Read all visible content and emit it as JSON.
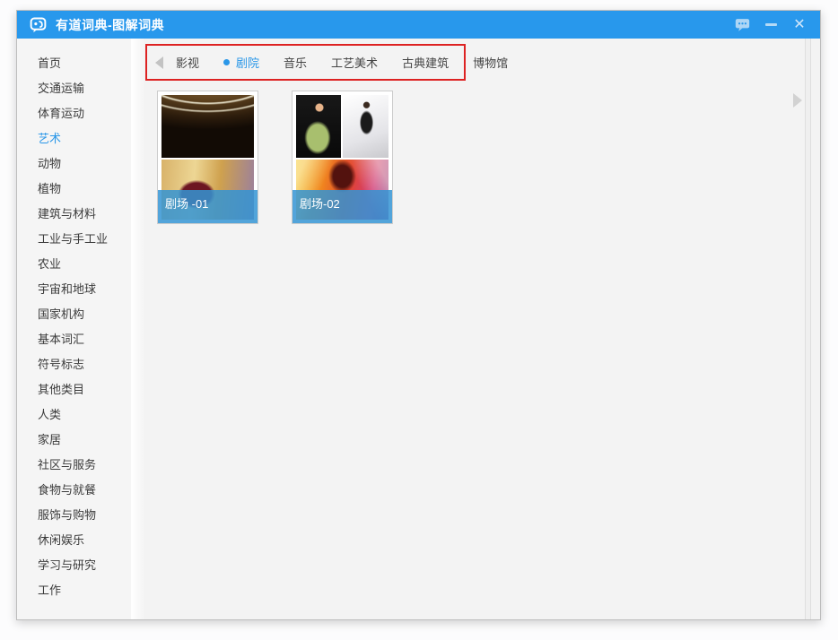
{
  "window": {
    "title": "有道词典-图解词典",
    "controls": [
      {
        "name": "feedback-message-icon"
      },
      {
        "name": "minimize-icon"
      },
      {
        "name": "close-icon",
        "glyph": "✕"
      }
    ]
  },
  "colors": {
    "titlebar": "#2898ec",
    "accent": "#2a97e8",
    "annotation_border": "#dd2222",
    "card_label_overlay": "rgba(52,148,211,0.85)"
  },
  "sidebar": {
    "items": [
      {
        "label": "首页",
        "selected": false
      },
      {
        "label": "交通运输",
        "selected": false
      },
      {
        "label": "体育运动",
        "selected": false
      },
      {
        "label": "艺术",
        "selected": true
      },
      {
        "label": "动物",
        "selected": false
      },
      {
        "label": "植物",
        "selected": false
      },
      {
        "label": "建筑与材料",
        "selected": false
      },
      {
        "label": "工业与手工业",
        "selected": false
      },
      {
        "label": "农业",
        "selected": false
      },
      {
        "label": "宇宙和地球",
        "selected": false
      },
      {
        "label": "国家机构",
        "selected": false
      },
      {
        "label": "基本词汇",
        "selected": false
      },
      {
        "label": "符号标志",
        "selected": false
      },
      {
        "label": "其他类目",
        "selected": false
      },
      {
        "label": "人类",
        "selected": false
      },
      {
        "label": "家居",
        "selected": false
      },
      {
        "label": "社区与服务",
        "selected": false
      },
      {
        "label": "食物与就餐",
        "selected": false
      },
      {
        "label": "服饰与购物",
        "selected": false
      },
      {
        "label": "休闲娱乐",
        "selected": false
      },
      {
        "label": "学习与研究",
        "selected": false
      },
      {
        "label": "工作",
        "selected": false
      }
    ]
  },
  "tabs": {
    "prev_icon": "chevron-left-icon",
    "next_icon": "chevron-right-icon",
    "items": [
      {
        "label": "影视",
        "selected": false
      },
      {
        "label": "剧院",
        "selected": true
      },
      {
        "label": "音乐",
        "selected": false
      },
      {
        "label": "工艺美术",
        "selected": false
      },
      {
        "label": "古典建筑",
        "selected": false
      },
      {
        "label": "博物馆",
        "selected": false
      }
    ]
  },
  "cards": [
    {
      "label": "剧场 -01",
      "photos": [
        "theater-ceiling-photo",
        "opera-house-photo"
      ]
    },
    {
      "label": "剧场-02",
      "photos": [
        "singer-photo",
        "ballerina-photo",
        "stage-lights-photo"
      ]
    }
  ]
}
